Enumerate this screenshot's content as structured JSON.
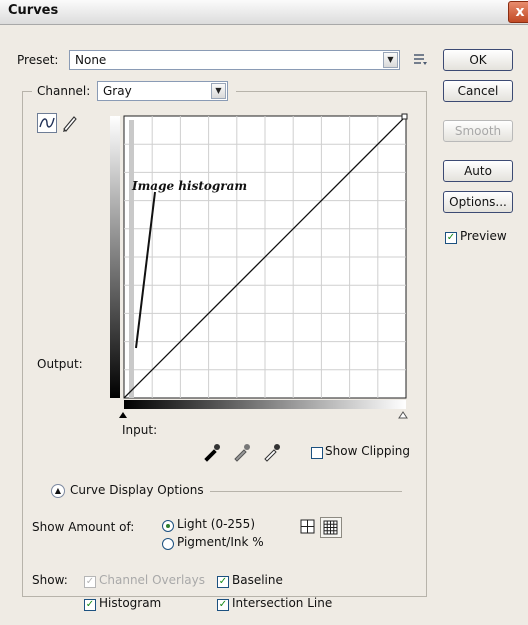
{
  "window": {
    "title": "Curves",
    "close_glyph": "x"
  },
  "preset": {
    "label": "Preset:",
    "value": "None"
  },
  "channel": {
    "label": "Channel:",
    "value": "Gray"
  },
  "buttons": {
    "ok": "OK",
    "cancel": "Cancel",
    "smooth": "Smooth",
    "auto": "Auto",
    "options": "Options...",
    "preview": "Preview"
  },
  "graph": {
    "output_label": "Output:",
    "input_label": "Input:",
    "annotation": "Image histogram"
  },
  "show_clipping": "Show Clipping",
  "curve_display_options": "Curve Display Options",
  "show_amount": {
    "label": "Show Amount of:",
    "light": "Light  (0-255)",
    "pigment": "Pigment/Ink %"
  },
  "show": {
    "label": "Show:",
    "channel_overlays": "Channel Overlays",
    "baseline": "Baseline",
    "histogram": "Histogram",
    "intersection_line": "Intersection Line"
  },
  "icons": {
    "preset_menu": "preset-options-icon",
    "curve_tool": "curve-point-tool-icon",
    "pencil_tool": "pencil-tool-icon",
    "eyedroppers": [
      "black-point-eyedropper-icon",
      "gray-point-eyedropper-icon",
      "white-point-eyedropper-icon"
    ],
    "grid_simple": "simple-grid-icon",
    "grid_detailed": "detailed-grid-icon",
    "collapse": "collapse-chevron-icon"
  },
  "colors": {
    "check": "#178a17",
    "accent_border": "#3c4a73"
  }
}
